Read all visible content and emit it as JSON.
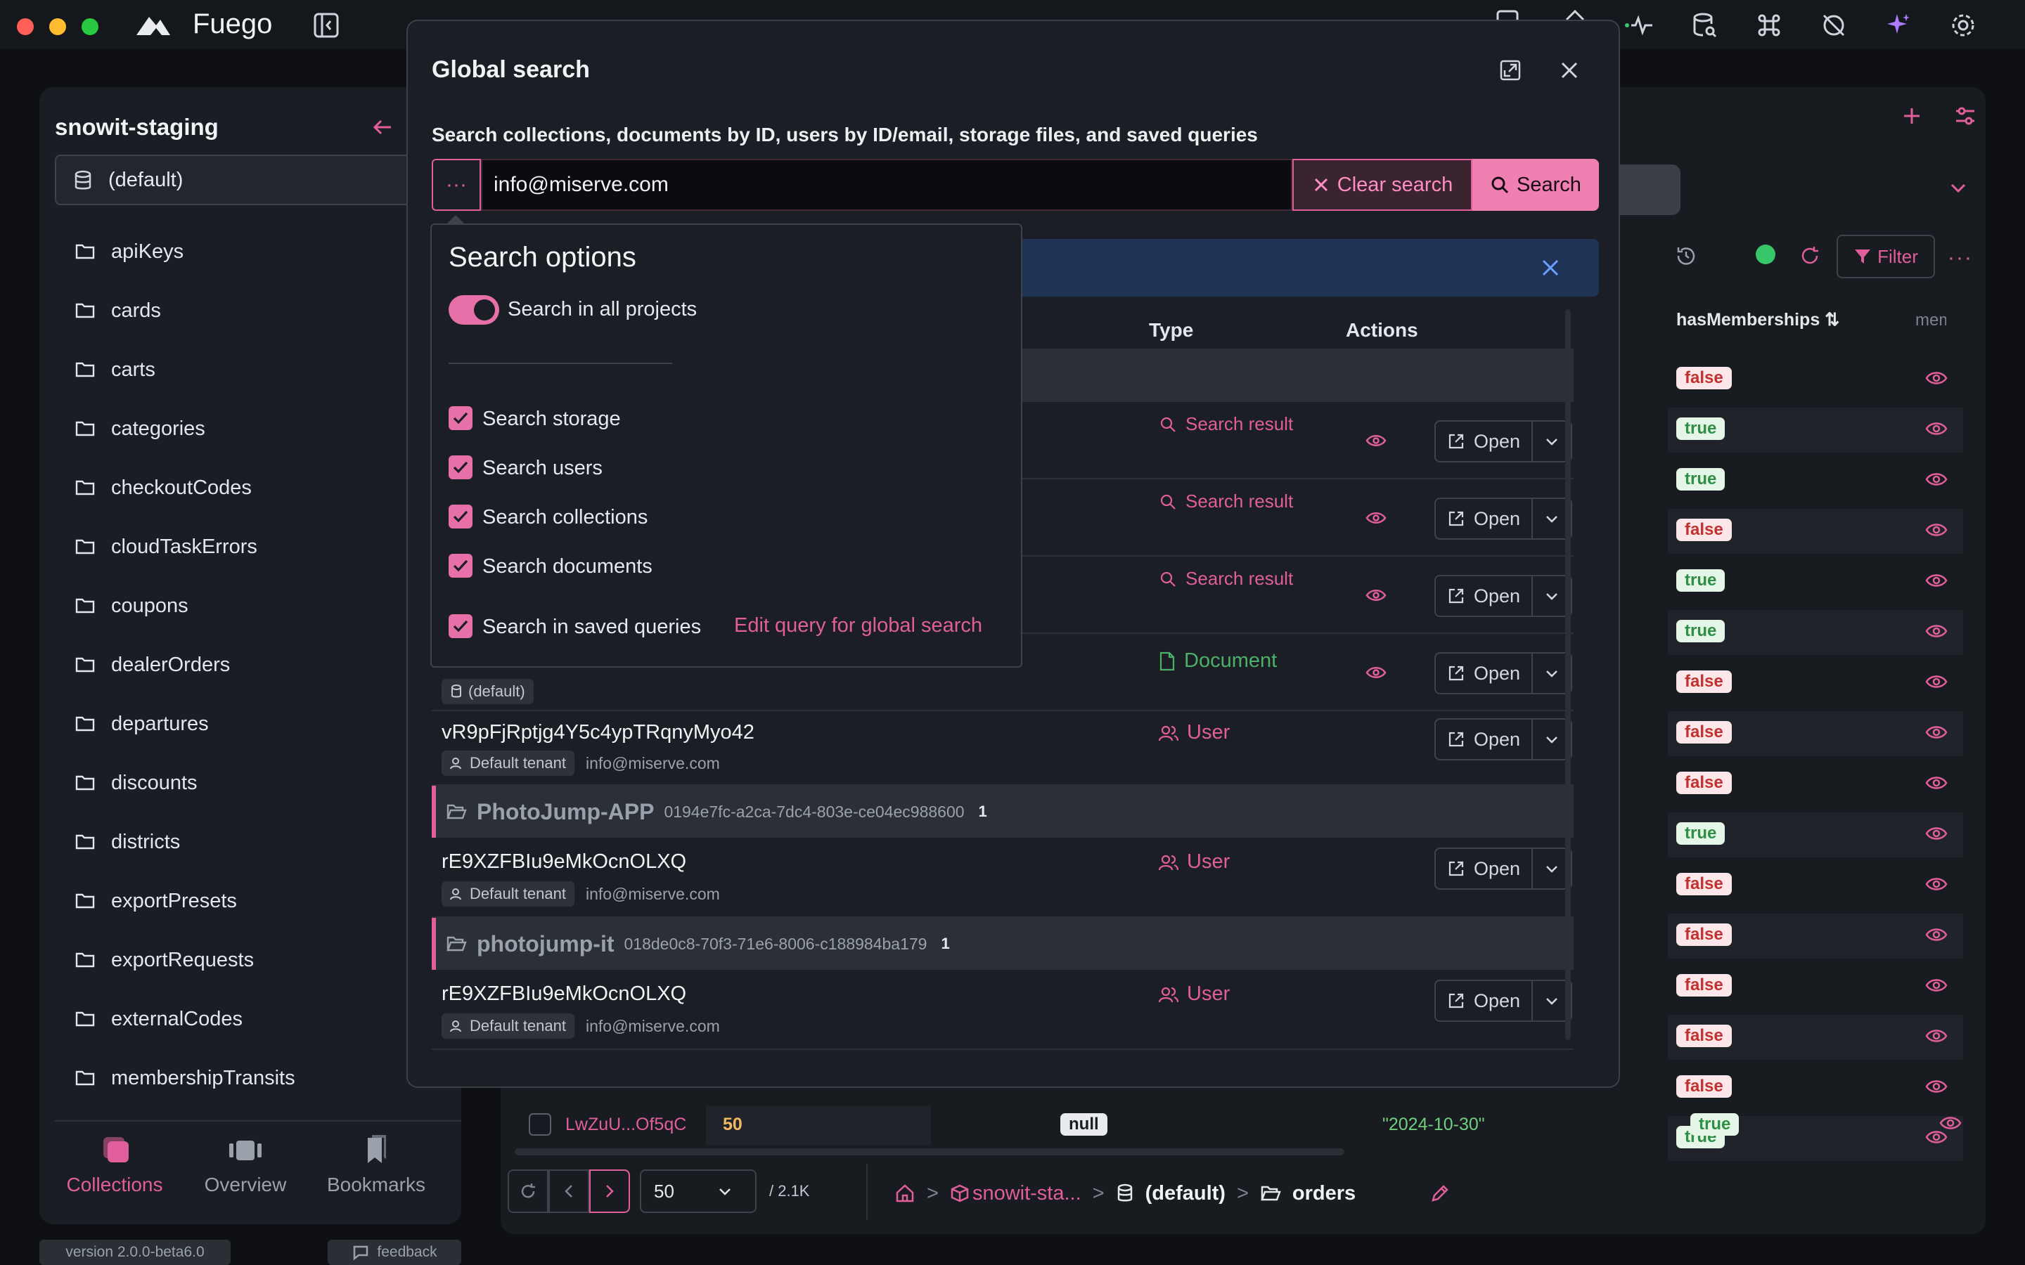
{
  "app": {
    "name": "Fuego",
    "version": "version 2.0.0-beta6.0",
    "feedback": "feedback"
  },
  "sidebar": {
    "project": "snowit-staging",
    "database": "(default)",
    "collections": [
      "apiKeys",
      "cards",
      "carts",
      "categories",
      "checkoutCodes",
      "cloudTaskErrors",
      "coupons",
      "dealerOrders",
      "departures",
      "discounts",
      "districts",
      "exportPresets",
      "exportRequests",
      "externalCodes",
      "membershipTransits"
    ],
    "tabs": [
      "Collections",
      "Overview",
      "Bookmarks"
    ]
  },
  "bg_table": {
    "filter_label": "Filter",
    "col_hasMemberships": "hasMemberships",
    "col_memb": "memb",
    "hasMemberships": [
      "false",
      "true",
      "true",
      "false",
      "true",
      "true",
      "false",
      "false",
      "false",
      "true",
      "false",
      "false",
      "false",
      "false",
      "false",
      "true"
    ],
    "last_row": {
      "id": "LwZuU...Of5qC",
      "num": "50",
      "val": "null",
      "date": "\"2024-10-30\"",
      "flag": "true"
    },
    "page_size": "50",
    "total": "/ 2.1K",
    "breadcrumb": [
      "snowit-sta...",
      "(default)",
      "orders"
    ]
  },
  "modal": {
    "title": "Global search",
    "subtitle": "Search collections, documents by ID, users by ID/email, storage files, and saved queries",
    "query": "info@miserve.com",
    "clear_label": "Clear search",
    "search_label": "Search",
    "col_type": "Type",
    "col_actions": "Actions",
    "open_label": "Open",
    "rows": [
      {
        "type": "Search result"
      },
      {
        "type": "Search result"
      },
      {
        "type": "Search result"
      },
      {
        "type": "Document",
        "db_tag": "(default)"
      }
    ],
    "user_row1": {
      "id": "vR9pFjRptjg4Y5c4ypTRqnyMyo42",
      "tenant": "Default tenant",
      "email": "info@miserve.com",
      "type": "User"
    },
    "groups": [
      {
        "name": "PhotoJump-APP",
        "uuid": "0194e7fc-a2ca-7dc4-803e-ce04ec988600",
        "count": "1",
        "user": {
          "id": "rE9XZFBIu9eMkOcnOLXQ",
          "tenant": "Default tenant",
          "email": "info@miserve.com",
          "type": "User"
        }
      },
      {
        "name": "photojump-it",
        "uuid": "018de0c8-70f3-71e6-8006-c188984ba179",
        "count": "1",
        "user": {
          "id": "rE9XZFBIu9eMkOcnOLXQ",
          "tenant": "Default tenant",
          "email": "info@miserve.com",
          "type": "User"
        }
      }
    ]
  },
  "search_options": {
    "title": "Search options",
    "all_projects": "Search in all projects",
    "storage": "Search storage",
    "users": "Search users",
    "collections": "Search collections",
    "documents": "Search documents",
    "saved_queries": "Search in saved queries",
    "edit_query": "Edit query for global search"
  },
  "colors": {
    "accent": "#e05f9a",
    "accent_light": "#f07fb2",
    "user": "#e05f9a",
    "document": "#4caf6a",
    "false": "#c53030",
    "true": "#2f8f43"
  }
}
